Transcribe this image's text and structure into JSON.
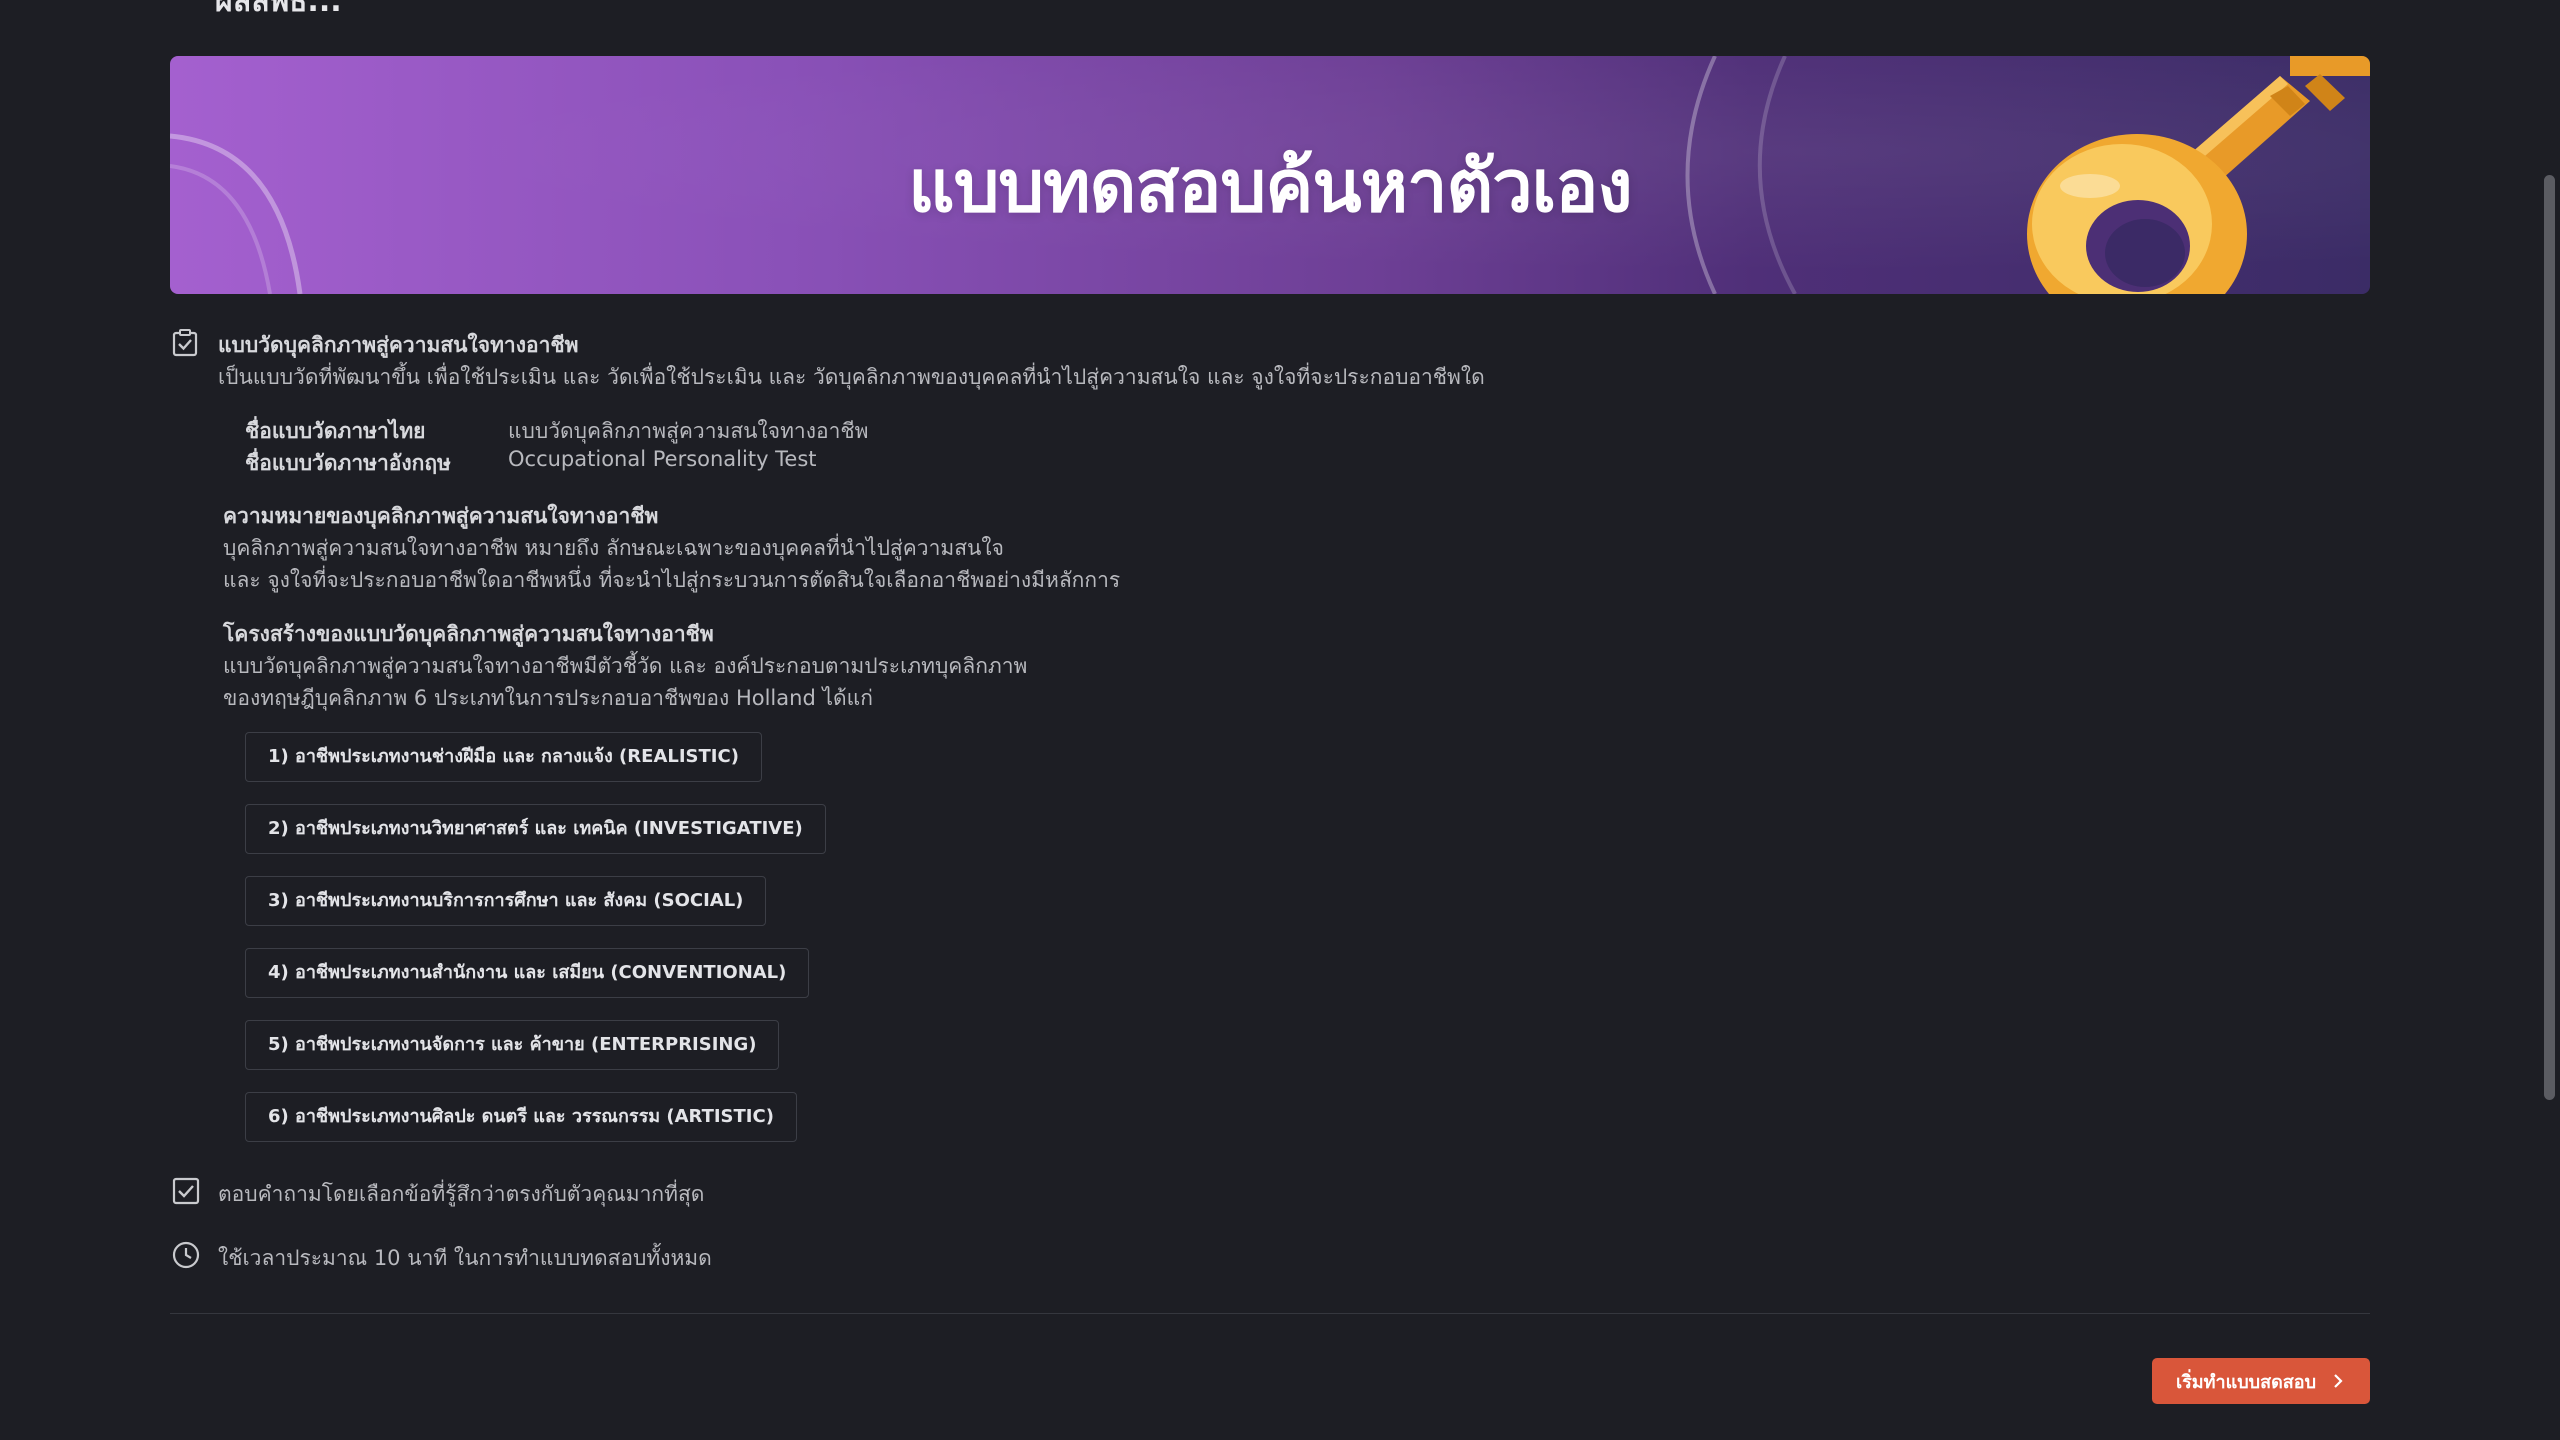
{
  "page_top_cut_text": "ผลลัพธ์...",
  "banner": {
    "title": "แบบทดสอบค้นหาตัวเอง"
  },
  "intro": {
    "title": "แบบวัดบุคลิกภาพสู่ความสนใจทางอาชีพ",
    "description": "เป็นแบบวัดที่พัฒนาขึ้น เพื่อใช้ประเมิน และ วัดเพื่อใช้ประเมิน และ วัดบุคลิกภาพของบุคคลที่นำไปสู่ความสนใจ และ จูงใจที่จะประกอบอาชีพใด"
  },
  "names": {
    "thai_label": "ชื่อแบบวัดภาษาไทย",
    "thai_value": "แบบวัดบุคลิกภาพสู่ความสนใจทางอาชีพ",
    "en_label": "ชื่อแบบวัดภาษาอังกฤษ",
    "en_value": "Occupational Personality Test"
  },
  "meaning": {
    "title": "ความหมายของบุคลิกภาพสู่ความสนใจทางอาชีพ",
    "line1": "บุคลิกภาพสู่ความสนใจทางอาชีพ หมายถึง ลักษณะเฉพาะของบุคคลที่นำไปสู่ความสนใจ",
    "line2": "และ จูงใจที่จะประกอบอาชีพใดอาชีพหนึ่ง ที่จะนำไปสู่กระบวนการตัดสินใจเลือกอาชีพอย่างมีหลักการ"
  },
  "structure": {
    "title": "โครงสร้างของแบบวัดบุคลิกภาพสู่ความสนใจทางอาชีพ",
    "line1": "แบบวัดบุคลิกภาพสู่ความสนใจทางอาชีพมีตัวชี้วัด และ องค์ประกอบตามประเภทบุคลิกภาพ",
    "line2": "ของทฤษฎีบุคลิกภาพ 6 ประเภทในการประกอบอาชีพของ Holland ได้แก่",
    "types": [
      "1) อาชีพประเภทงานช่างฝีมือ และ กลางแจ้ง (REALISTIC)",
      "2) อาชีพประเภทงานวิทยาศาสตร์ และ เทคนิค (INVESTIGATIVE)",
      "3) อาชีพประเภทงานบริการการศึกษา และ สังคม (SOCIAL)",
      "4) อาชีพประเภทงานสำนักงาน และ เสมียน (CONVENTIONAL)",
      "5) อาชีพประเภทงานจัดการ และ ค้าขาย (ENTERPRISING)",
      "6) อาชีพประเภทงานศิลปะ ดนตรี และ วรรณกรรม (ARTISTIC)"
    ]
  },
  "instruction": "ตอบคำถามโดยเลือกข้อที่รู้สึกว่าตรงกับตัวคุณมากที่สุด",
  "duration": "ใช้เวลาประมาณ 10 นาที ในการทำแบบทดสอบทั้งหมด",
  "start_button": "เริ่มทำแบบสดสอบ",
  "colors": {
    "background": "#1d1e24",
    "accent": "#d9563a",
    "banner_start": "#a460cf",
    "banner_end": "#3b2c66",
    "key_gold": "#f0a830"
  }
}
